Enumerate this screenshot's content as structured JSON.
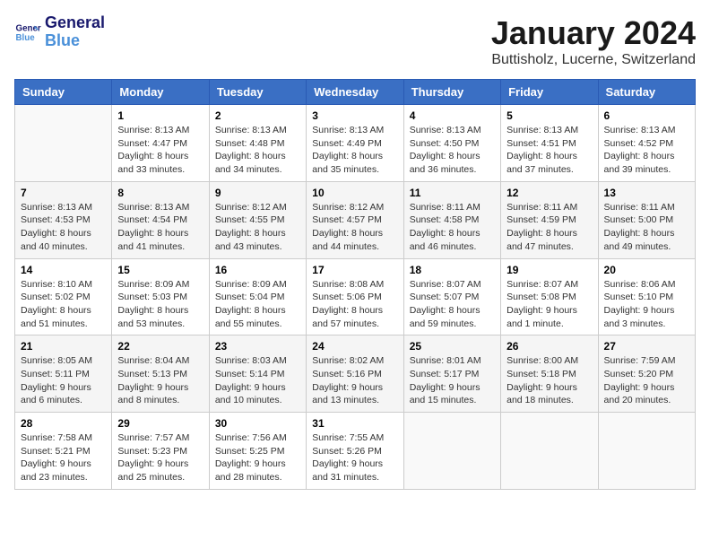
{
  "header": {
    "logo_line1": "General",
    "logo_line2": "Blue",
    "title": "January 2024",
    "subtitle": "Buttisholz, Lucerne, Switzerland"
  },
  "weekdays": [
    "Sunday",
    "Monday",
    "Tuesday",
    "Wednesday",
    "Thursday",
    "Friday",
    "Saturday"
  ],
  "weeks": [
    [
      {
        "day": "",
        "info": ""
      },
      {
        "day": "1",
        "info": "Sunrise: 8:13 AM\nSunset: 4:47 PM\nDaylight: 8 hours\nand 33 minutes."
      },
      {
        "day": "2",
        "info": "Sunrise: 8:13 AM\nSunset: 4:48 PM\nDaylight: 8 hours\nand 34 minutes."
      },
      {
        "day": "3",
        "info": "Sunrise: 8:13 AM\nSunset: 4:49 PM\nDaylight: 8 hours\nand 35 minutes."
      },
      {
        "day": "4",
        "info": "Sunrise: 8:13 AM\nSunset: 4:50 PM\nDaylight: 8 hours\nand 36 minutes."
      },
      {
        "day": "5",
        "info": "Sunrise: 8:13 AM\nSunset: 4:51 PM\nDaylight: 8 hours\nand 37 minutes."
      },
      {
        "day": "6",
        "info": "Sunrise: 8:13 AM\nSunset: 4:52 PM\nDaylight: 8 hours\nand 39 minutes."
      }
    ],
    [
      {
        "day": "7",
        "info": "Sunrise: 8:13 AM\nSunset: 4:53 PM\nDaylight: 8 hours\nand 40 minutes."
      },
      {
        "day": "8",
        "info": "Sunrise: 8:13 AM\nSunset: 4:54 PM\nDaylight: 8 hours\nand 41 minutes."
      },
      {
        "day": "9",
        "info": "Sunrise: 8:12 AM\nSunset: 4:55 PM\nDaylight: 8 hours\nand 43 minutes."
      },
      {
        "day": "10",
        "info": "Sunrise: 8:12 AM\nSunset: 4:57 PM\nDaylight: 8 hours\nand 44 minutes."
      },
      {
        "day": "11",
        "info": "Sunrise: 8:11 AM\nSunset: 4:58 PM\nDaylight: 8 hours\nand 46 minutes."
      },
      {
        "day": "12",
        "info": "Sunrise: 8:11 AM\nSunset: 4:59 PM\nDaylight: 8 hours\nand 47 minutes."
      },
      {
        "day": "13",
        "info": "Sunrise: 8:11 AM\nSunset: 5:00 PM\nDaylight: 8 hours\nand 49 minutes."
      }
    ],
    [
      {
        "day": "14",
        "info": "Sunrise: 8:10 AM\nSunset: 5:02 PM\nDaylight: 8 hours\nand 51 minutes."
      },
      {
        "day": "15",
        "info": "Sunrise: 8:09 AM\nSunset: 5:03 PM\nDaylight: 8 hours\nand 53 minutes."
      },
      {
        "day": "16",
        "info": "Sunrise: 8:09 AM\nSunset: 5:04 PM\nDaylight: 8 hours\nand 55 minutes."
      },
      {
        "day": "17",
        "info": "Sunrise: 8:08 AM\nSunset: 5:06 PM\nDaylight: 8 hours\nand 57 minutes."
      },
      {
        "day": "18",
        "info": "Sunrise: 8:07 AM\nSunset: 5:07 PM\nDaylight: 8 hours\nand 59 minutes."
      },
      {
        "day": "19",
        "info": "Sunrise: 8:07 AM\nSunset: 5:08 PM\nDaylight: 9 hours\nand 1 minute."
      },
      {
        "day": "20",
        "info": "Sunrise: 8:06 AM\nSunset: 5:10 PM\nDaylight: 9 hours\nand 3 minutes."
      }
    ],
    [
      {
        "day": "21",
        "info": "Sunrise: 8:05 AM\nSunset: 5:11 PM\nDaylight: 9 hours\nand 6 minutes."
      },
      {
        "day": "22",
        "info": "Sunrise: 8:04 AM\nSunset: 5:13 PM\nDaylight: 9 hours\nand 8 minutes."
      },
      {
        "day": "23",
        "info": "Sunrise: 8:03 AM\nSunset: 5:14 PM\nDaylight: 9 hours\nand 10 minutes."
      },
      {
        "day": "24",
        "info": "Sunrise: 8:02 AM\nSunset: 5:16 PM\nDaylight: 9 hours\nand 13 minutes."
      },
      {
        "day": "25",
        "info": "Sunrise: 8:01 AM\nSunset: 5:17 PM\nDaylight: 9 hours\nand 15 minutes."
      },
      {
        "day": "26",
        "info": "Sunrise: 8:00 AM\nSunset: 5:18 PM\nDaylight: 9 hours\nand 18 minutes."
      },
      {
        "day": "27",
        "info": "Sunrise: 7:59 AM\nSunset: 5:20 PM\nDaylight: 9 hours\nand 20 minutes."
      }
    ],
    [
      {
        "day": "28",
        "info": "Sunrise: 7:58 AM\nSunset: 5:21 PM\nDaylight: 9 hours\nand 23 minutes."
      },
      {
        "day": "29",
        "info": "Sunrise: 7:57 AM\nSunset: 5:23 PM\nDaylight: 9 hours\nand 25 minutes."
      },
      {
        "day": "30",
        "info": "Sunrise: 7:56 AM\nSunset: 5:25 PM\nDaylight: 9 hours\nand 28 minutes."
      },
      {
        "day": "31",
        "info": "Sunrise: 7:55 AM\nSunset: 5:26 PM\nDaylight: 9 hours\nand 31 minutes."
      },
      {
        "day": "",
        "info": ""
      },
      {
        "day": "",
        "info": ""
      },
      {
        "day": "",
        "info": ""
      }
    ]
  ]
}
